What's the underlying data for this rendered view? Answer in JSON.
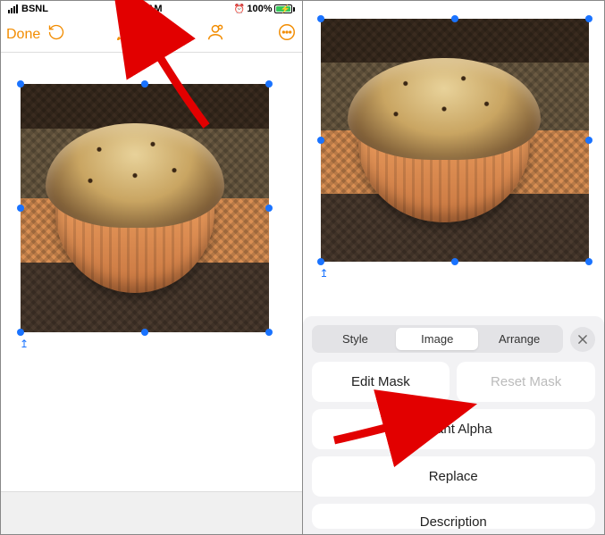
{
  "statusbar": {
    "carrier": "BSNL",
    "time": "11:19 AM",
    "battery_percent": "100%",
    "alarm_icon": "⏰"
  },
  "toolbar": {
    "done": "Done"
  },
  "format_panel": {
    "tabs": {
      "style": "Style",
      "image": "Image",
      "arrange": "Arrange"
    },
    "edit_mask": "Edit Mask",
    "reset_mask": "Reset Mask",
    "instant_alpha": "Instant Alpha",
    "replace": "Replace",
    "description": "Description"
  }
}
